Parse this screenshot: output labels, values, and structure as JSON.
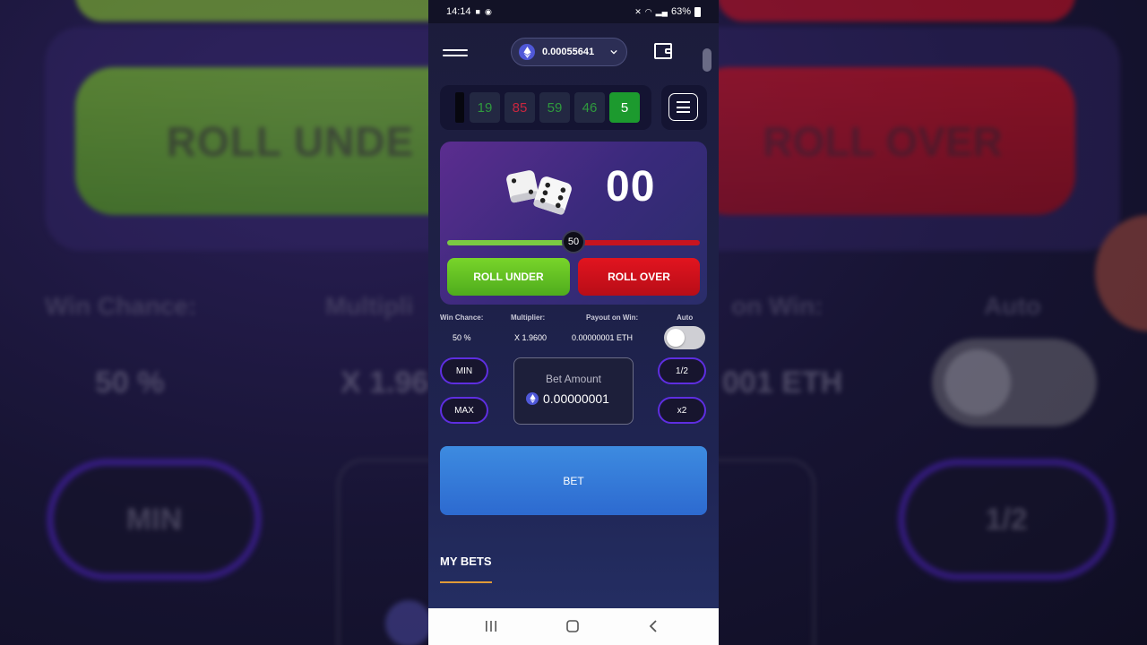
{
  "status_bar": {
    "time": "14:14",
    "battery": "63%"
  },
  "header": {
    "balance": "0.00055641"
  },
  "history": {
    "items": [
      {
        "value": "19",
        "color": "green"
      },
      {
        "value": "85",
        "color": "red"
      },
      {
        "value": "59",
        "color": "green"
      },
      {
        "value": "46",
        "color": "green"
      },
      {
        "value": "5",
        "color": "active"
      }
    ]
  },
  "game": {
    "result": "00",
    "slider_value": "50",
    "slider_fraction": 0.5,
    "roll_under_label": "ROLL UNDER",
    "roll_over_label": "ROLL OVER"
  },
  "stats": {
    "win_chance_label": "Win Chance:",
    "win_chance_value": "50 %",
    "multiplier_label": "Multiplier:",
    "multiplier_value": "X 1.9600",
    "payout_label": "Payout on Win:",
    "payout_value": "0.00000001 ETH",
    "auto_label": "Auto",
    "auto_enabled": false
  },
  "bet_controls": {
    "min_label": "MIN",
    "max_label": "MAX",
    "half_label": "1/2",
    "double_label": "x2",
    "bet_amount_label": "Bet Amount",
    "bet_amount_value": "0.00000001",
    "bet_button_label": "BET"
  },
  "my_bets_label": "MY BETS",
  "background": {
    "roll_under_text": "ROLL UNDE",
    "roll_over_text": "ROLL OVER",
    "win_chance_text": "Win Chance:",
    "multiplier_text": "Multipli",
    "payout_text": "on Win:",
    "auto_text": "Auto",
    "win_chance_value_text": "50 %",
    "multiplier_value_text": "X 1.96",
    "payout_value_text": "001 ETH",
    "min_text": "MIN",
    "half_text": "1/2"
  },
  "colors": {
    "accent_blue": "#3d8be0",
    "roll_under_green": "#79d42a",
    "roll_over_red": "#e2141f",
    "pill_border": "#5e2ee0",
    "tab_underline": "#e09a37"
  }
}
